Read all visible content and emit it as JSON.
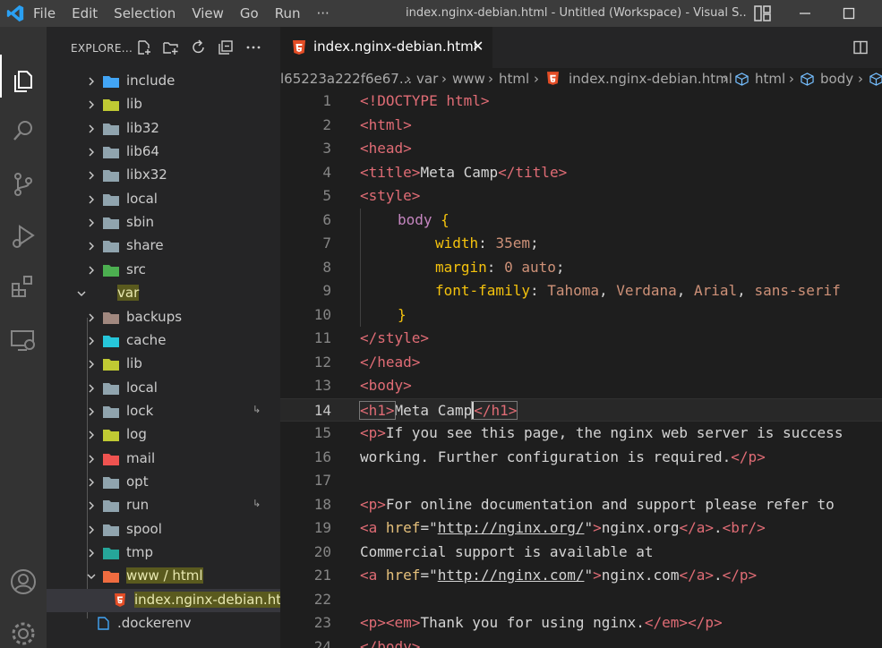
{
  "titlebar": {
    "menu": [
      "File",
      "Edit",
      "Selection",
      "View",
      "Go",
      "Run",
      "···"
    ],
    "title": "index.nginx-debian.html - Untitled (Workspace) - Visual S..."
  },
  "sidebar": {
    "title": "EXPLORE...",
    "items": [
      {
        "label": "include",
        "icon": "folder-include-icon",
        "color": "#42a5f5"
      },
      {
        "label": "lib",
        "icon": "folder-lib-icon",
        "color": "#c0ca33"
      },
      {
        "label": "lib32",
        "icon": "folder-icon",
        "color": "#90a4ae"
      },
      {
        "label": "lib64",
        "icon": "folder-icon",
        "color": "#90a4ae"
      },
      {
        "label": "libx32",
        "icon": "folder-icon",
        "color": "#90a4ae"
      },
      {
        "label": "local",
        "icon": "folder-icon",
        "color": "#90a4ae"
      },
      {
        "label": "sbin",
        "icon": "folder-icon",
        "color": "#90a4ae"
      },
      {
        "label": "share",
        "icon": "folder-icon",
        "color": "#90a4ae"
      },
      {
        "label": "src",
        "icon": "folder-src-icon",
        "color": "#4caf50"
      },
      {
        "label": "var",
        "icon": "none",
        "color": ""
      },
      {
        "label": "backups",
        "icon": "folder-backup-icon",
        "color": "#a1887f"
      },
      {
        "label": "cache",
        "icon": "folder-cache-icon",
        "color": "#26c6da"
      },
      {
        "label": "lib",
        "icon": "folder-lib-icon",
        "color": "#c0ca33"
      },
      {
        "label": "local",
        "icon": "folder-icon",
        "color": "#90a4ae"
      },
      {
        "label": "lock",
        "icon": "folder-icon",
        "color": "#90a4ae",
        "badge": "↳"
      },
      {
        "label": "log",
        "icon": "folder-log-icon",
        "color": "#c0ca33"
      },
      {
        "label": "mail",
        "icon": "folder-mail-icon",
        "color": "#ef5350"
      },
      {
        "label": "opt",
        "icon": "folder-icon",
        "color": "#90a4ae"
      },
      {
        "label": "run",
        "icon": "folder-icon",
        "color": "#90a4ae",
        "badge": "↳"
      },
      {
        "label": "spool",
        "icon": "folder-icon",
        "color": "#90a4ae"
      },
      {
        "label": "tmp",
        "icon": "folder-temp-icon",
        "color": "#26a69a"
      },
      {
        "label": "www / html",
        "icon": "folder-html-icon",
        "color": "#ef6c40"
      },
      {
        "label": "index.nginx-debian.ht...",
        "icon": "html-file-icon",
        "color": "#e44d26"
      },
      {
        "label": ".dockerenv",
        "icon": "file-icon",
        "color": "#42a5f5"
      }
    ]
  },
  "tab": {
    "label": "index.nginx-debian.html",
    "close": "✕"
  },
  "breadcrumb": [
    "l65223a222f6e67...",
    "var",
    "www",
    "html",
    "index.nginx-debian.html",
    "html",
    "body"
  ],
  "editor": {
    "line_numbers": [
      "1",
      "2",
      "3",
      "4",
      "5",
      "6",
      "7",
      "8",
      "9",
      "10",
      "11",
      "12",
      "13",
      "14",
      "15",
      "16",
      "17",
      "18",
      "19",
      "20",
      "21",
      "22",
      "23",
      "24"
    ],
    "lines": {
      "l1": "<!DOCTYPE html>",
      "l2": "<html>",
      "l3": "<head>",
      "l4a": "<title>",
      "l4b": "Meta Camp",
      "l4c": "</title>",
      "l5": "<style>",
      "l6a": "body",
      "l6b": "{",
      "l7a": "width",
      "l7b": ": ",
      "l7c": "35em",
      "l7d": ";",
      "l8a": "margin",
      "l8b": ": ",
      "l8c": "0 auto",
      "l8d": ";",
      "l9a": "font-family",
      "l9b": ": ",
      "l9c": "Tahoma",
      "l9d": ", ",
      "l9e": "Verdana",
      "l9f": ", ",
      "l9g": "Arial",
      "l9h": ", ",
      "l9i": "sans-serif",
      "l10": "}",
      "l11": "</style>",
      "l12": "</head>",
      "l13": "<body>",
      "l14a": "<h1>",
      "l14b": "Meta Camp",
      "l14c": "</h1>",
      "l15a": "<p>",
      "l15b": "If you see this page, the nginx web server is success",
      "l16a": "working. Further configuration is required.",
      "l16b": "</p>",
      "l18a": "<p>",
      "l18b": "For online documentation and support please refer to",
      "l19a": "<a ",
      "l19b": "href",
      "l19c": "=\"",
      "l19d": "http://nginx.org/",
      "l19e": "\"",
      "l19f": ">",
      "l19g": "nginx.org",
      "l19h": "</a>",
      "l19i": ".",
      "l19j": "<br/>",
      "l20": "Commercial support is available at",
      "l21a": "<a ",
      "l21b": "href",
      "l21c": "=\"",
      "l21d": "http://nginx.com/",
      "l21e": "\"",
      "l21f": ">",
      "l21g": "nginx.com",
      "l21h": "</a>",
      "l21i": ".",
      "l21j": "</p>",
      "l23a": "<p>",
      "l23b": "<em>",
      "l23c": "Thank you for using nginx.",
      "l23d": "</em>",
      "l23e": "</p>",
      "l24": "</body>"
    }
  },
  "colors": {
    "accent": "#007acc",
    "highlight": "#5a5a1e"
  }
}
